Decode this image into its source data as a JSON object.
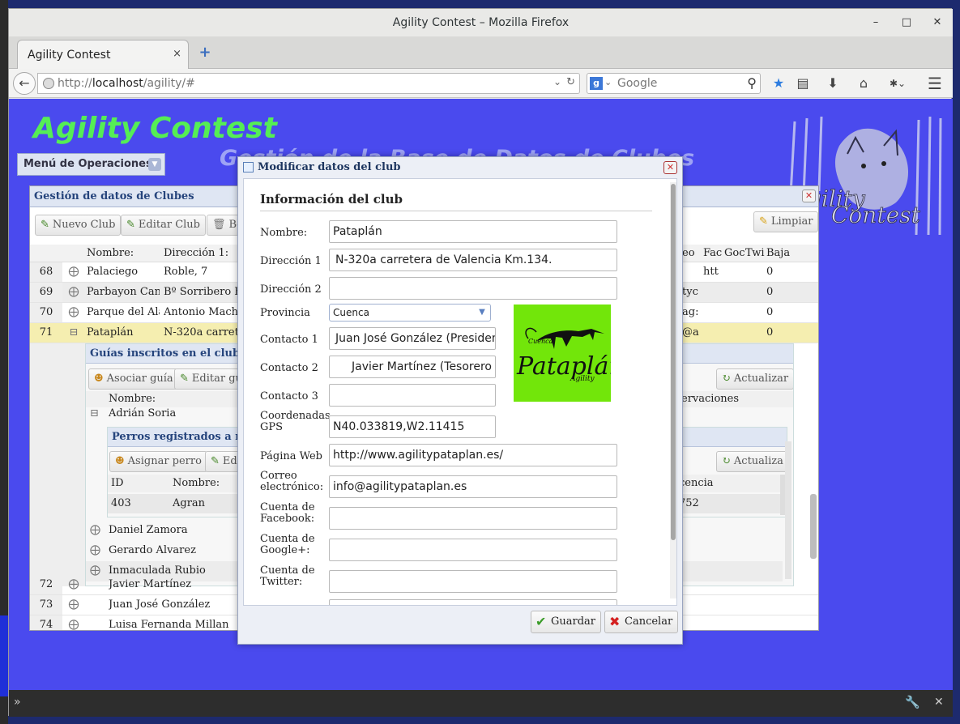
{
  "window": {
    "title": "Agility Contest – Mozilla Firefox"
  },
  "tab": {
    "label": "Agility Contest",
    "close": "×",
    "new": "+"
  },
  "nav": {
    "url_prefix": "http://",
    "url_host": "localhost",
    "url_path": "/agility/#",
    "search_placeholder": "Google"
  },
  "app": {
    "title": "Agility Contest",
    "subtitle": "Gestión de la Base de Datos de Clubes",
    "menu_label": "Menú de Operaciones"
  },
  "panel": {
    "title": "Gestión de datos de Clubes",
    "toolbar": {
      "new": "Nuevo Club",
      "edit": "Editar Club",
      "delete": "Bo",
      "clear": "Limpiar"
    },
    "columns": [
      "Nombre:",
      "Dirección 1:",
      "eo",
      "Fac",
      "Goc",
      "Twi",
      "Baja"
    ],
    "rows": [
      {
        "num": "68",
        "nombre": "Palaciego",
        "dir": "Roble, 7",
        "extra": "htt",
        "baja": "0"
      },
      {
        "num": "69",
        "nombre": "Parbayon Cant",
        "dir": "Bº Sorribero Ba",
        "extra": "tyc",
        "baja": "0"
      },
      {
        "num": "70",
        "nombre": "Parque del Ala",
        "dir": "Antonio Machín",
        "extra": "ag:",
        "baja": "0"
      },
      {
        "num": "71",
        "nombre": "Pataplán",
        "dir": "N-320a carrete",
        "extra": "@a",
        "baja": "0"
      },
      {
        "num": "72",
        "nombre": "Javier Martínez"
      },
      {
        "num": "73",
        "nombre": "Juan José González"
      },
      {
        "num": "74",
        "nombre": "Luisa Fernanda Millan"
      }
    ],
    "guides": {
      "title": "Guías inscritos en el club I",
      "assign": "Asociar guía",
      "edit": "Editar gu",
      "refresh": "Actualizar",
      "col_name": "Nombre:",
      "col_obs": "ervaciones",
      "first": "Adrián Soria",
      "others": [
        "Daniel Zamora",
        "Gerardo Alvarez",
        "Inmaculada Rubio"
      ]
    },
    "dogs": {
      "title": "Perros registrados a n",
      "assign": "Asignar perro",
      "edit": "Edi",
      "refresh": "Actualiza",
      "col_id": "ID",
      "col_name": "Nombre:",
      "col_lic": "cencia",
      "row_id": "403",
      "row_name": "Agran",
      "row_lic": "752"
    }
  },
  "dialog": {
    "title": "Modificar datos del club",
    "section": "Información del club",
    "labels": {
      "nombre": "Nombre:",
      "dir1": "Dirección 1",
      "dir2": "Dirección 2",
      "provincia": "Provincia",
      "contacto1": "Contacto 1",
      "contacto2": "Contacto 2",
      "contacto3": "Contacto 3",
      "gps": "Coordenadas GPS",
      "web": "Página Web",
      "email": "Correo electrónico:",
      "facebook": "Cuenta de Facebook:",
      "google": "Cuenta de Google+:",
      "twitter": "Cuenta de Twitter:"
    },
    "values": {
      "nombre": "Pataplán",
      "dir1": "N-320a carretera de Valencia Km.134.",
      "dir2": "",
      "provincia": "Cuenca",
      "contacto1": "Juan José González (President",
      "contacto2": "Javier Martínez (Tesorero",
      "contacto3": "",
      "gps": "N40.033819,W2.11415",
      "web": "http://www.agilitypataplan.es/",
      "email": "info@agilitypataplan.es",
      "facebook": "",
      "google": "",
      "twitter": ""
    },
    "logo": {
      "text": "Pataplán",
      "small_top": "Cuenca",
      "small_bottom": "Agility",
      "color": "#72e60a"
    },
    "buttons": {
      "save": "Guardar",
      "cancel": "Cancelar"
    }
  },
  "colors": {
    "page_bg": "#4a4aee",
    "app_title": "#55ee55",
    "selected_row": "#f5eeb0"
  }
}
